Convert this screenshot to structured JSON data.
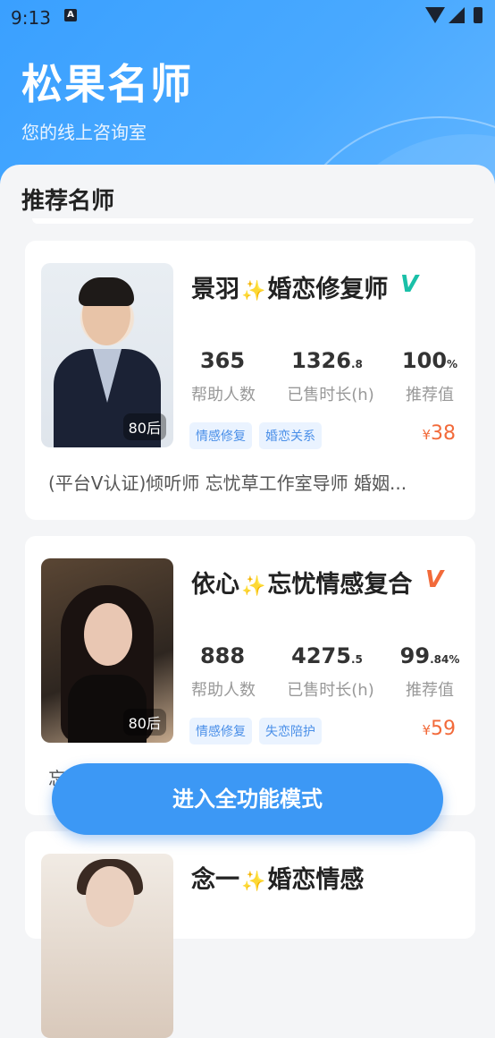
{
  "status_bar": {
    "time": "9:13",
    "notification_glyph": "A"
  },
  "header": {
    "title": "松果名师",
    "subtitle": "您的线上咨询室"
  },
  "section": {
    "title": "推荐名师"
  },
  "cards": [
    {
      "name": "景羽",
      "role": "婚恋修复师",
      "verified_color": "#1ac0a8",
      "age": "80后",
      "stats": [
        {
          "value": "1326",
          "suffix": ".8",
          "label": "已售时长(h)"
        }
      ],
      "helped": "365",
      "helped_label": "帮助人数",
      "rec_value": "100",
      "rec_suffix": "%",
      "rec_label": "推荐值",
      "tags": [
        "情感修复",
        "婚恋关系"
      ],
      "price": "38",
      "currency": "¥",
      "desc": "(平台V认证)倾听师    忘忧草工作室导师    婚姻..."
    },
    {
      "name": "依心",
      "role": "忘忧情感复合",
      "verified_color": "#f26a3a",
      "age": "80后",
      "stats": [
        {
          "value": "4275",
          "suffix": ".5",
          "label": "已售时长(h)"
        }
      ],
      "helped": "888",
      "helped_label": "帮助人数",
      "rec_value": "99",
      "rec_suffix": ".84%",
      "rec_label": "推荐值",
      "tags": [
        "情感修复",
        "失恋陪护"
      ],
      "price": "59",
      "currency": "¥",
      "desc": "忘"
    },
    {
      "name": "念一",
      "role": "婚恋情感"
    }
  ],
  "fab": {
    "label": "进入全功能模式"
  }
}
